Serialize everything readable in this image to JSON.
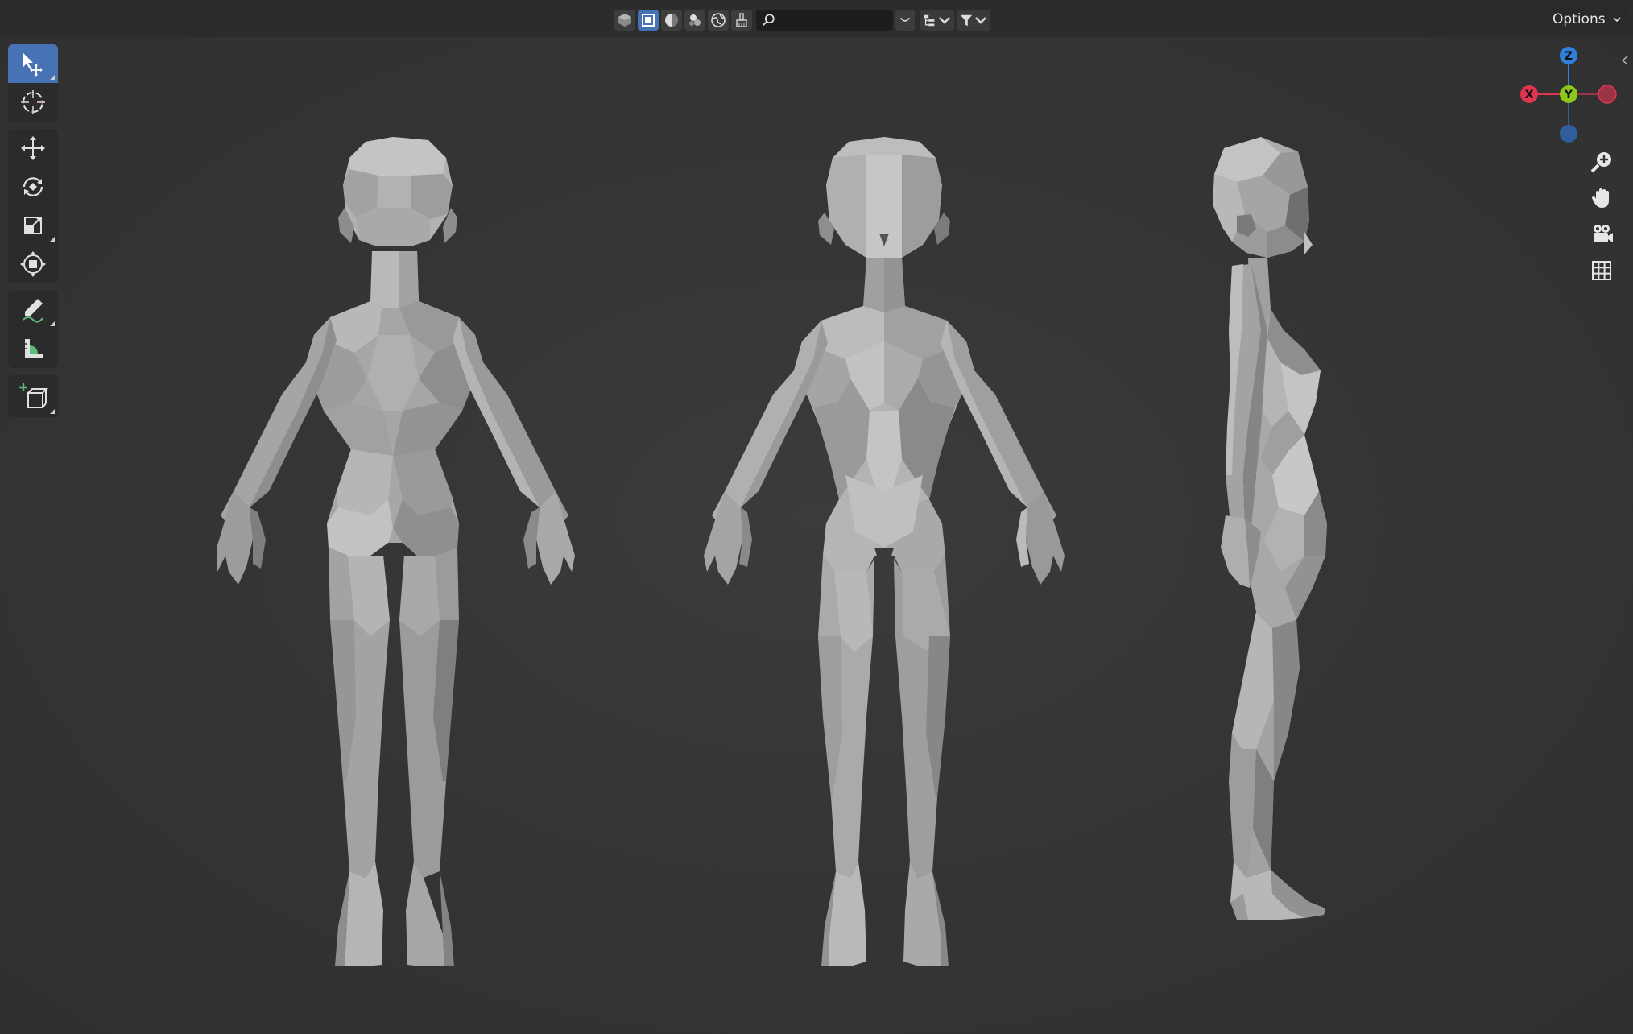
{
  "header": {
    "options_label": "Options",
    "search": {
      "value": "",
      "placeholder": ""
    },
    "buttons": [
      {
        "name": "object-mode-icon"
      },
      {
        "name": "select-box-icon",
        "active": true
      },
      {
        "name": "material-sphere-icon"
      },
      {
        "name": "shading-mode-icon"
      },
      {
        "name": "world-icon"
      },
      {
        "name": "brush-icon"
      }
    ]
  },
  "toolbar": {
    "tools": [
      {
        "name": "select-box",
        "icon": "cursor-arrow-icon",
        "active": true
      },
      {
        "name": "cursor",
        "icon": "crosshair-cursor-icon"
      },
      {
        "name": "move",
        "icon": "move-arrows-icon"
      },
      {
        "name": "rotate",
        "icon": "rotate-icon"
      },
      {
        "name": "scale",
        "icon": "scale-icon"
      },
      {
        "name": "transform",
        "icon": "transform-icon"
      },
      {
        "name": "annotate",
        "icon": "pencil-annotate-icon"
      },
      {
        "name": "measure",
        "icon": "ruler-measure-icon"
      },
      {
        "name": "add-cube",
        "icon": "add-cube-icon"
      }
    ]
  },
  "gizmo": {
    "z_label": "Z",
    "x_label": "X",
    "y_label": "Y",
    "colors": {
      "x": "#e0344f",
      "y": "#8bc919",
      "z": "#2f7fdb",
      "neg": "#9a3344",
      "negz": "#2e5f9c"
    }
  },
  "nav": [
    "zoom-icon",
    "pan-hand-icon",
    "camera-icon",
    "grid-icon"
  ],
  "colors": {
    "viewport": "#353535",
    "accent": "#4772b3",
    "model_light": "#bdbdbd",
    "model_mid": "#9a9a9a",
    "model_dark": "#6f6f6f"
  }
}
